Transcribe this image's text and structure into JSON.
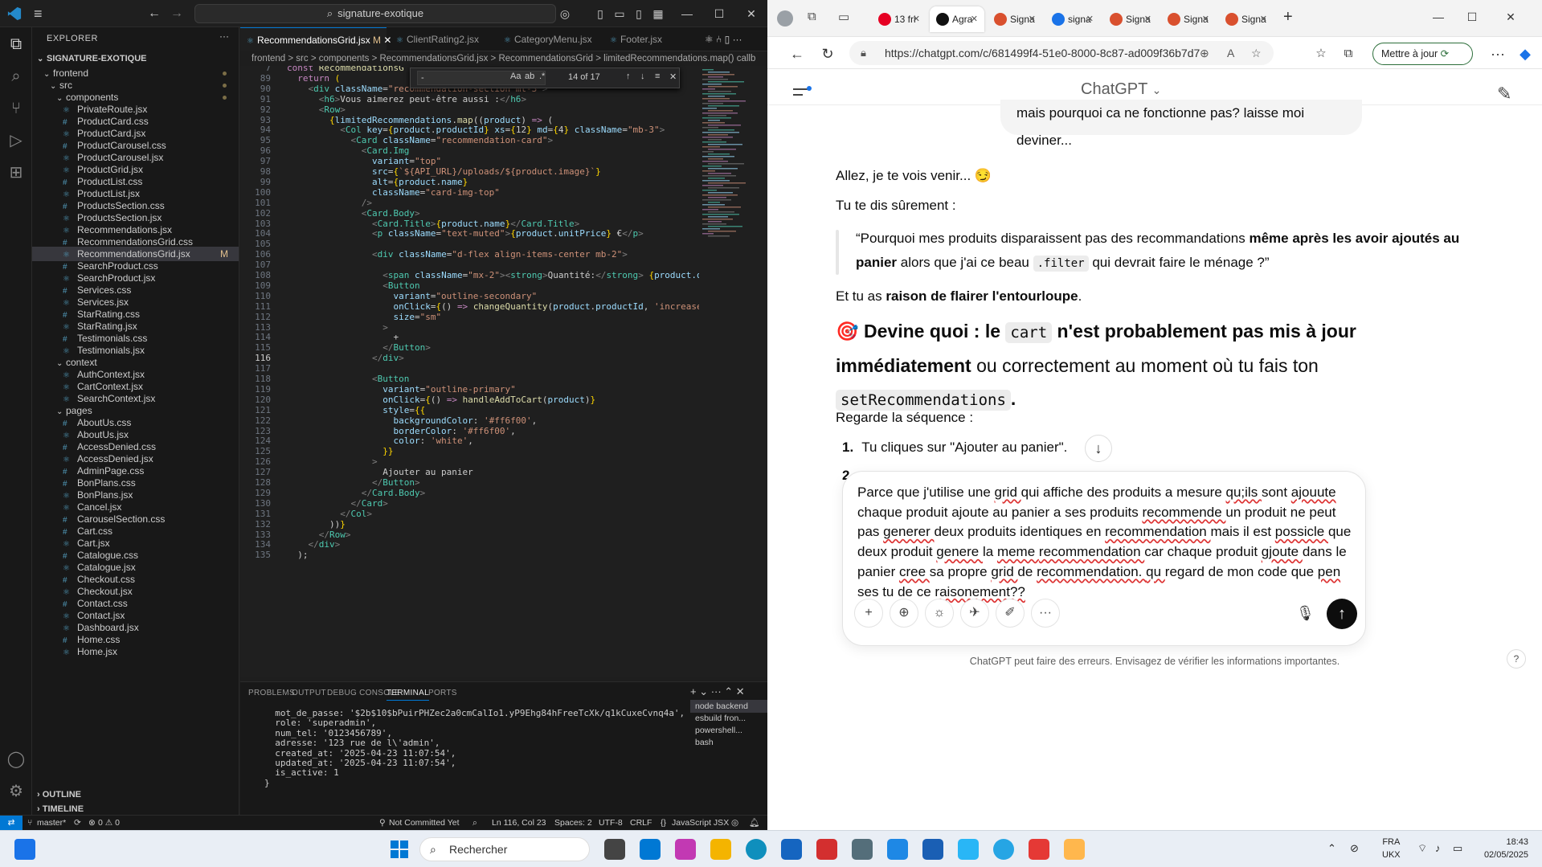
{
  "vscode": {
    "search_text": "signature-exotique",
    "explorer_title": "EXPLORER",
    "project_name": "SIGNATURE-EXOTIQUE",
    "tree": [
      {
        "label": "frontend",
        "kind": "folder"
      },
      {
        "label": "src",
        "kind": "folder"
      },
      {
        "label": "components",
        "kind": "folder"
      },
      {
        "label": "PrivateRoute.jsx",
        "kind": "jsx"
      },
      {
        "label": "ProductCard.css",
        "kind": "css"
      },
      {
        "label": "ProductCard.jsx",
        "kind": "jsx"
      },
      {
        "label": "ProductCarousel.css",
        "kind": "css"
      },
      {
        "label": "ProductCarousel.jsx",
        "kind": "jsx"
      },
      {
        "label": "ProductGrid.jsx",
        "kind": "jsx"
      },
      {
        "label": "ProductList.css",
        "kind": "css"
      },
      {
        "label": "ProductList.jsx",
        "kind": "jsx"
      },
      {
        "label": "ProductsSection.css",
        "kind": "css"
      },
      {
        "label": "ProductsSection.jsx",
        "kind": "jsx"
      },
      {
        "label": "Recommendations.jsx",
        "kind": "jsx"
      },
      {
        "label": "RecommendationsGrid.css",
        "kind": "css"
      },
      {
        "label": "RecommendationsGrid.jsx",
        "kind": "jsx",
        "badge": "M"
      },
      {
        "label": "SearchProduct.css",
        "kind": "css"
      },
      {
        "label": "SearchProduct.jsx",
        "kind": "jsx"
      },
      {
        "label": "Services.css",
        "kind": "css"
      },
      {
        "label": "Services.jsx",
        "kind": "jsx"
      },
      {
        "label": "StarRating.css",
        "kind": "css"
      },
      {
        "label": "StarRating.jsx",
        "kind": "jsx"
      },
      {
        "label": "Testimonials.css",
        "kind": "css"
      },
      {
        "label": "Testimonials.jsx",
        "kind": "jsx"
      },
      {
        "label": "context",
        "kind": "folder"
      },
      {
        "label": "AuthContext.jsx",
        "kind": "jsx"
      },
      {
        "label": "CartContext.jsx",
        "kind": "jsx"
      },
      {
        "label": "SearchContext.jsx",
        "kind": "jsx"
      },
      {
        "label": "pages",
        "kind": "folder"
      },
      {
        "label": "AboutUs.css",
        "kind": "css"
      },
      {
        "label": "AboutUs.jsx",
        "kind": "jsx"
      },
      {
        "label": "AccessDenied.css",
        "kind": "css"
      },
      {
        "label": "AccessDenied.jsx",
        "kind": "jsx"
      },
      {
        "label": "AdminPage.css",
        "kind": "css"
      },
      {
        "label": "BonPlans.css",
        "kind": "css"
      },
      {
        "label": "BonPlans.jsx",
        "kind": "jsx"
      },
      {
        "label": "Cancel.jsx",
        "kind": "jsx"
      },
      {
        "label": "CarouselSection.css",
        "kind": "css"
      },
      {
        "label": "Cart.css",
        "kind": "css"
      },
      {
        "label": "Cart.jsx",
        "kind": "jsx"
      },
      {
        "label": "Catalogue.css",
        "kind": "css"
      },
      {
        "label": "Catalogue.jsx",
        "kind": "jsx"
      },
      {
        "label": "Checkout.css",
        "kind": "css"
      },
      {
        "label": "Checkout.jsx",
        "kind": "jsx"
      },
      {
        "label": "Contact.css",
        "kind": "css"
      },
      {
        "label": "Contact.jsx",
        "kind": "jsx"
      },
      {
        "label": "Dashboard.jsx",
        "kind": "jsx"
      },
      {
        "label": "Home.css",
        "kind": "css"
      },
      {
        "label": "Home.jsx",
        "kind": "jsx"
      }
    ],
    "outline_label": "OUTLINE",
    "timeline_label": "TIMELINE",
    "tabs": [
      {
        "label": "RecommendationsGrid.jsx",
        "badge": "M",
        "active": true
      },
      {
        "label": "ClientRating2.jsx"
      },
      {
        "label": "CategoryMenu.jsx"
      },
      {
        "label": "Footer.jsx"
      }
    ],
    "breadcrumb": "frontend > src > components > RecommendationsGrid.jsx > RecommendationsGrid > limitedRecommendations.map() callb",
    "find": {
      "value": "-",
      "count": "14 of 17"
    },
    "panel_tabs": [
      "PROBLEMS",
      "OUTPUT",
      "DEBUG CONSOLE",
      "TERMINAL",
      "PORTS"
    ],
    "terminal_lines": [
      "  mot_de_passe: '$2b$10$bPuirPHZec2a0cmCalIo1.yP9Ehg84hFreeTcXk/q1kCuxeCvnq4a',",
      "  role: 'superadmin',",
      "  num_tel: '0123456789',",
      "  adresse: '123 rue de l\\'admin',",
      "  created_at: '2025-04-23 11:07:54',",
      "  updated_at: '2025-04-23 11:07:54',",
      "  is_active: 1",
      "}"
    ],
    "terminal_list": [
      "node backend",
      "esbuild fron...",
      "powershell...",
      "bash"
    ],
    "status": {
      "branch": "master*",
      "problems": "0 ⚠ 0",
      "commit": "Not Committed Yet",
      "position": "Ln 116, Col 23",
      "spaces": "Spaces: 2",
      "encoding": "UTF-8",
      "eol": "CRLF",
      "language": "JavaScript JSX"
    }
  },
  "edge": {
    "tabs": [
      {
        "label": "13 fri",
        "color": "#e60023"
      },
      {
        "label": "Agra",
        "color": "#111111",
        "active": true
      },
      {
        "label": "Signa",
        "color": "#d9502e"
      },
      {
        "label": "signa",
        "color": "#1a73e8"
      },
      {
        "label": "Signa",
        "color": "#d9502e"
      },
      {
        "label": "Signa",
        "color": "#d9502e"
      },
      {
        "label": "Signa",
        "color": "#d9502e"
      }
    ],
    "url": "https://chatgpt.com/c/681499f4-51e0-8000-8c87-ad009f36b7d7",
    "update_label": "Mettre à jour",
    "chat_title": "ChatGPT",
    "user_msg": "mais pourquoi ca ne fonctionne pas? laisse moi deviner...",
    "p1": "Allez, je te vois venir... 😏",
    "p2": "Tu te dis sûrement :",
    "quote_a": "“Pourquoi mes produits disparaissent pas des recommandations ",
    "quote_b": "même après les avoir ajoutés au panier",
    "quote_c": " alors que j'ai ce beau ",
    "quote_code": ".filter",
    "quote_d": " qui devrait faire le ménage ?”",
    "p3a": "Et tu as ",
    "p3b": "raison de flairer l'entourloupe",
    "p3c": ".",
    "big_a": "🎯 Devine quoi : le ",
    "big_code": "cart",
    "big_b": " n'est probablement ",
    "big_c": "pas mis à jour immédiatement",
    "big_d": " ou correctement au moment où tu fais ton ",
    "big_code2": "setRecommendations",
    "big_e": ".",
    "p4": "Regarde la séquence :",
    "li1": "Tu cliques sur \"Ajouter au panier\".",
    "li2_num": "2.",
    "composer_text": "Parce que j'utilise une grid qui affiche des produits a mesure qu;ils sont ajouute chaque produit ajoute au panier a ses produits recommende un produit ne peut pas generer deux produits identiques en recommendation mais il est possicle que deux produit genere la meme recommendation car chaque produit gjoute dans le panier cree sa propre grid de recommendation. qu regard de mon code que pen ses tu de ce raisonement??",
    "disclaimer": "ChatGPT peut faire des erreurs. Envisagez de vérifier les informations importantes.",
    "help": "?"
  },
  "taskbar": {
    "search_placeholder": "Rechercher",
    "lang": "FRA",
    "kbd": "UKX",
    "time": "18:43",
    "date": "02/05/2025"
  }
}
